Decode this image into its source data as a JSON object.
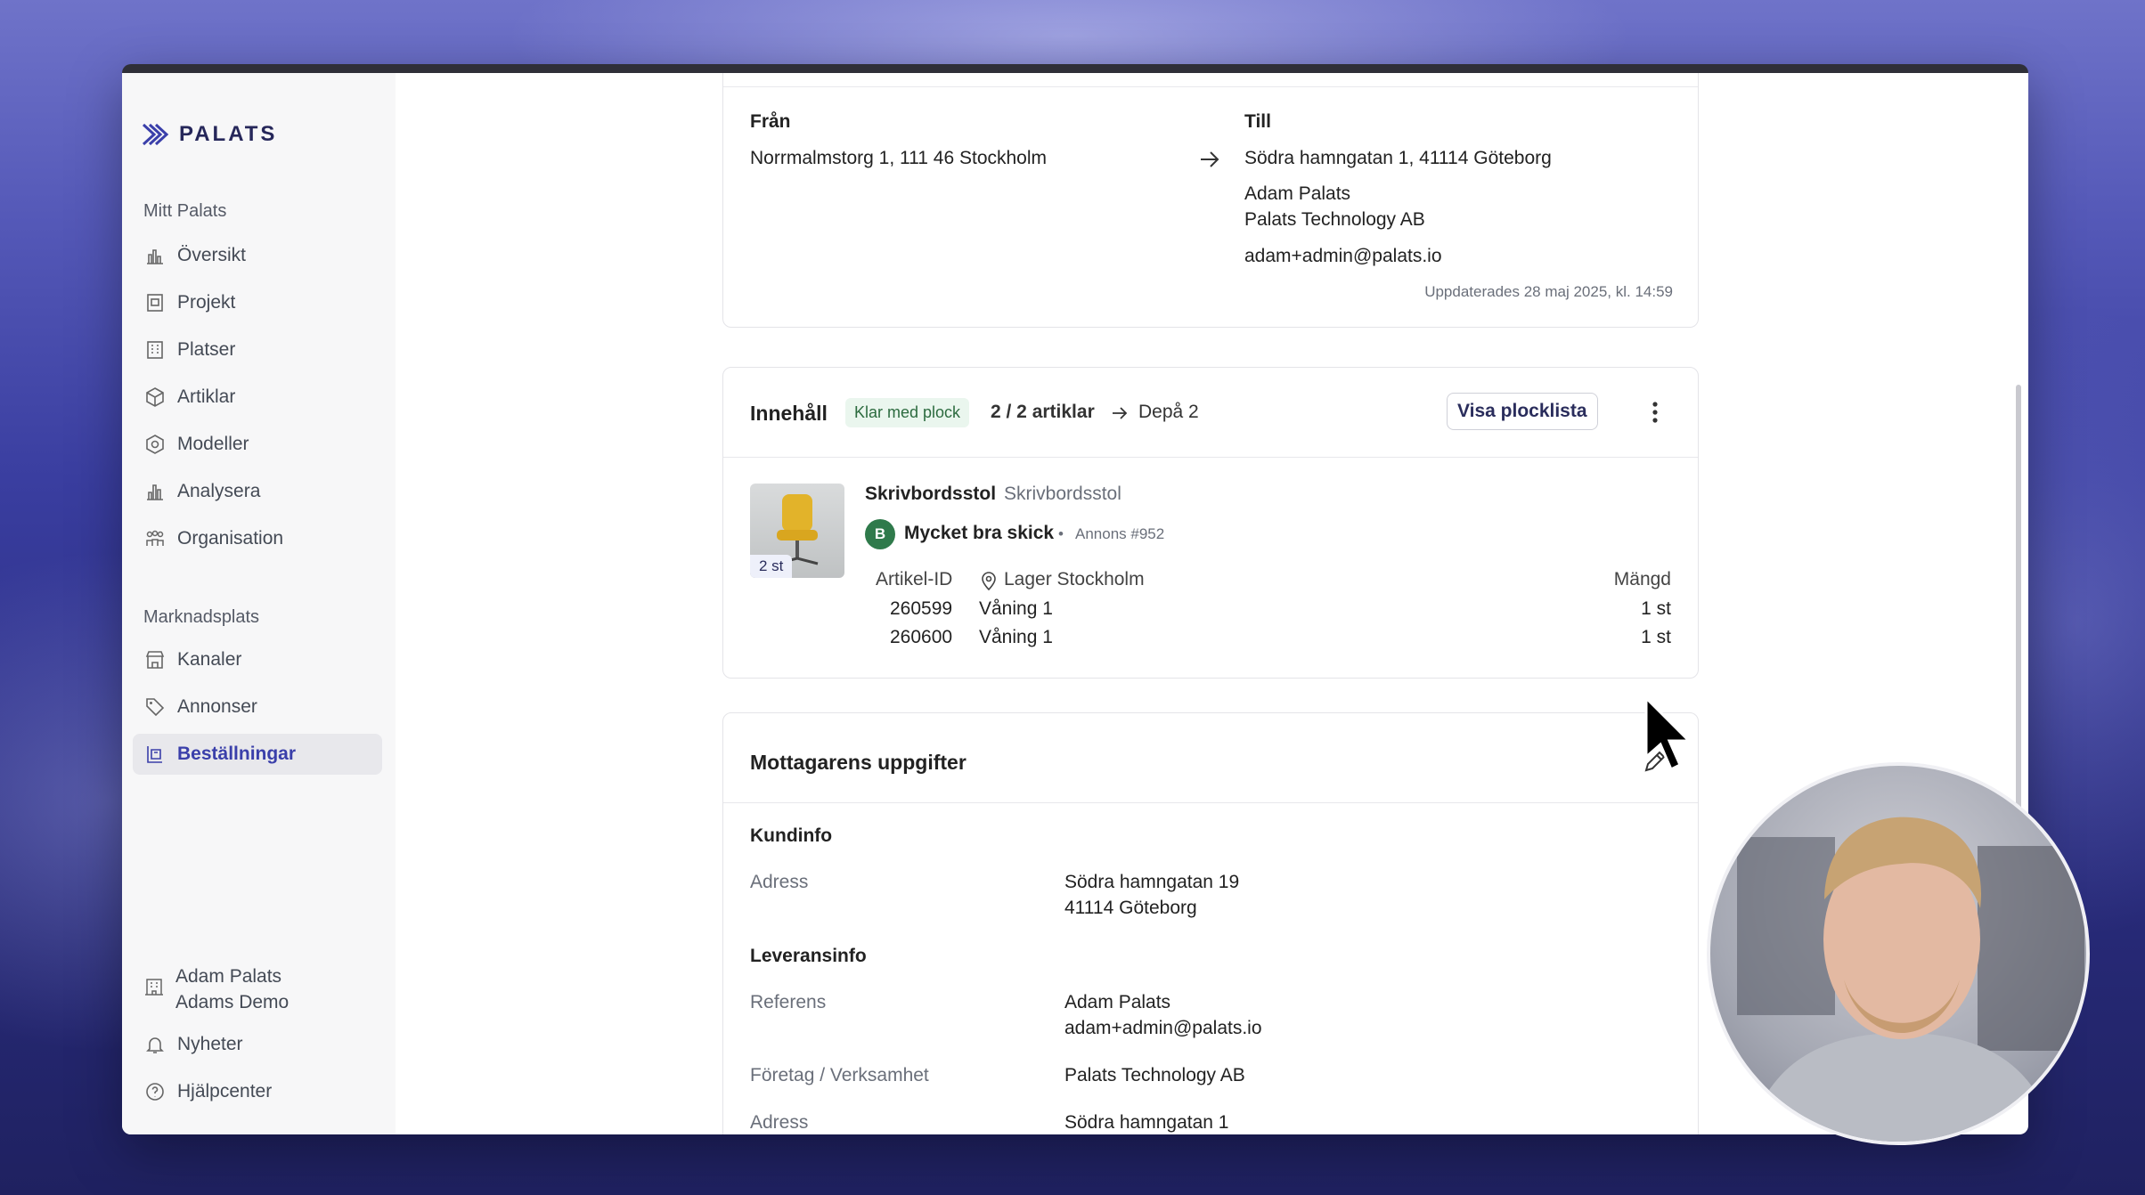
{
  "brand": {
    "name": "PALATS"
  },
  "sidebar": {
    "section_my": "Mitt Palats",
    "items_my": [
      {
        "label": "Översikt",
        "icon": "chart-icon"
      },
      {
        "label": "Projekt",
        "icon": "project-icon"
      },
      {
        "label": "Platser",
        "icon": "building-icon"
      },
      {
        "label": "Artiklar",
        "icon": "box-icon"
      },
      {
        "label": "Modeller",
        "icon": "hexagon-icon"
      },
      {
        "label": "Analysera",
        "icon": "bar-chart-icon"
      },
      {
        "label": "Organisation",
        "icon": "people-icon"
      }
    ],
    "section_market": "Marknadsplats",
    "items_market": [
      {
        "label": "Kanaler",
        "icon": "store-icon"
      },
      {
        "label": "Annonser",
        "icon": "tag-icon"
      },
      {
        "label": "Beställningar",
        "icon": "orders-icon",
        "active": true
      }
    ],
    "account": {
      "name": "Adam Palats",
      "org": "Adams Demo"
    },
    "news": "Nyheter",
    "help": "Hjälpcenter"
  },
  "shipping": {
    "from_label": "Från",
    "from_address": "Norrmalmstorg 1, 111 46 Stockholm",
    "to_label": "Till",
    "to_address": "Södra hamngatan 1, 41114 Göteborg",
    "to_name": "Adam Palats",
    "to_company": "Palats Technology AB",
    "to_email": "adam+admin@palats.io",
    "updated": "Uppdaterades 28 maj 2025, kl. 14:59"
  },
  "content": {
    "title": "Innehåll",
    "status_chip": "Klar med plock",
    "count": "2 / 2 artiklar",
    "depot": "Depå 2",
    "picklist_button": "Visa plocklista",
    "item": {
      "name": "Skrivbordsstol",
      "category": "Skrivbordsstol",
      "thumb_qty": "2 st",
      "grade": "B",
      "condition": "Mycket bra skick",
      "ad": "Annons #952",
      "col_id": "Artikel-ID",
      "location": "Lager Stockholm",
      "col_qty": "Mängd",
      "rows": [
        {
          "id": "260599",
          "floor": "Våning 1",
          "qty": "1 st"
        },
        {
          "id": "260600",
          "floor": "Våning 1",
          "qty": "1 st"
        }
      ]
    }
  },
  "recipient": {
    "title": "Mottagarens uppgifter",
    "customer_heading": "Kundinfo",
    "address_label": "Adress",
    "address_line1": "Södra hamngatan 19",
    "address_line2": "41114 Göteborg",
    "delivery_heading": "Leveransinfo",
    "reference_label": "Referens",
    "reference_name": "Adam Palats",
    "reference_email": "adam+admin@palats.io",
    "company_label": "Företag / Verksamhet",
    "company_value": "Palats Technology AB",
    "address2_label": "Adress",
    "address2_value": "Södra hamngatan 1"
  }
}
